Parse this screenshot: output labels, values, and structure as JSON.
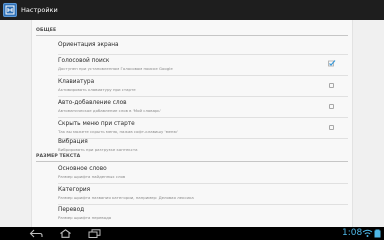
{
  "app": {
    "title": "Настройки",
    "icon": "translator-app-icon"
  },
  "sections": [
    {
      "label": "ОБЩЕЕ"
    },
    {
      "label": "РАЗМЕР ТЕКСТА"
    }
  ],
  "prefs": [
    {
      "title": "Ориентация экрана",
      "summary": "",
      "checkbox": null
    },
    {
      "title": "Голосовой поиск",
      "summary": "Доступен при установленном Голосовом поиске Google",
      "checkbox": true
    },
    {
      "title": "Клавиатура",
      "summary": "Активировать клавиатуру при старте",
      "checkbox": false
    },
    {
      "title": "Авто-добавление слов",
      "summary": "Автоматическое добавление слов в 'Мой словарь'",
      "checkbox": false
    },
    {
      "title": "Скрыть меню при старте",
      "summary": "Так вы можете скрыть меню, нажав софт-клавишу 'меню'",
      "checkbox": false
    },
    {
      "title": "Вибрация",
      "summary": "Вибрировать при разгрузке контекста",
      "checkbox": null
    },
    {
      "title": "Основное слово",
      "summary": "Размер шрифта найденных слов",
      "checkbox": null
    },
    {
      "title": "Категория",
      "summary": "Размер шрифта названия категории, например: Деловая лексика",
      "checkbox": null
    },
    {
      "title": "Перевод",
      "summary": "Размер шрифта перевода",
      "checkbox": null
    }
  ],
  "status_bar": {
    "time": "1:08",
    "icons": [
      "back-icon",
      "home-icon",
      "recent-apps-icon",
      "wifi-icon",
      "battery-icon"
    ]
  },
  "colors": {
    "accent": "#4fb8e8",
    "action_bar": "#1e1e1e",
    "check": "#3a9ad9"
  }
}
